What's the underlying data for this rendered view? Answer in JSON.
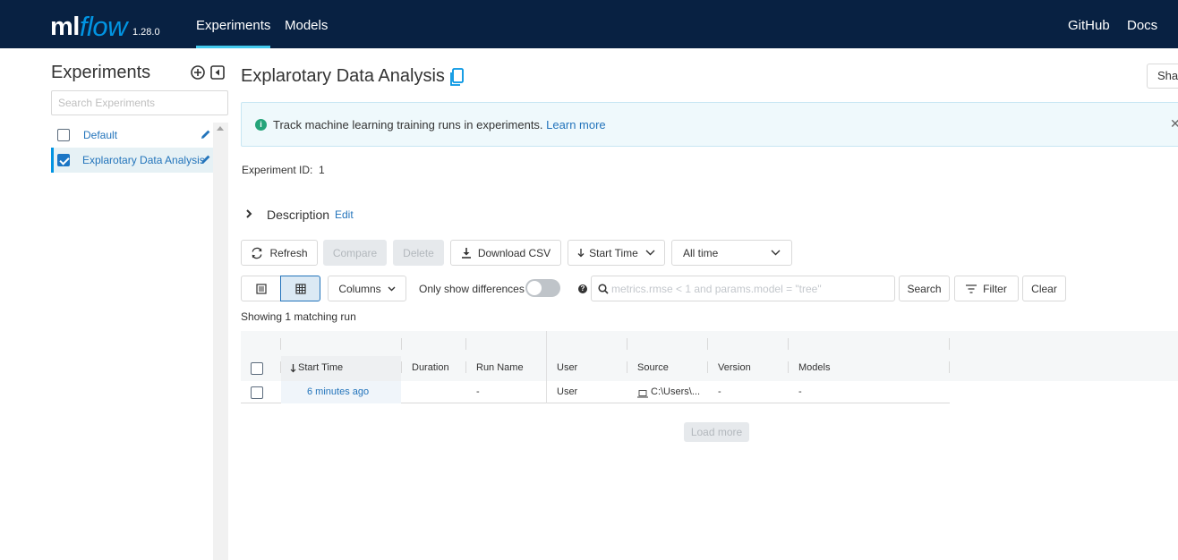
{
  "app": {
    "logo_ml": "ml",
    "logo_flow": "flow",
    "version": "1.28.0"
  },
  "nav": {
    "experiments": "Experiments",
    "models": "Models",
    "github": "GitHub",
    "docs": "Docs"
  },
  "sidebar": {
    "title": "Experiments",
    "search_placeholder": "Search Experiments",
    "items": [
      {
        "label": "Default",
        "checked": false
      },
      {
        "label": "Explarotary Data Analysis",
        "checked": true
      }
    ]
  },
  "experiment": {
    "title": "Explarotary Data Analysis",
    "share_label": "Share",
    "alert_text": "Track machine learning training runs in experiments.",
    "alert_link": "Learn more",
    "id_label": "Experiment ID:",
    "id_value": "1",
    "description_label": "Description",
    "description_edit": "Edit"
  },
  "toolbar": {
    "refresh": "Refresh",
    "compare": "Compare",
    "delete": "Delete",
    "download_csv": "Download CSV",
    "sort": "Start Time",
    "time_range": "All time",
    "columns": "Columns",
    "only_show_differences": "Only show differences",
    "search_placeholder": "metrics.rmse < 1 and params.model = \"tree\"",
    "search": "Search",
    "filter": "Filter",
    "clear": "Clear"
  },
  "runs": {
    "showing": "Showing 1 matching run",
    "columns": [
      "Start Time",
      "Duration",
      "Run Name",
      "User",
      "Source",
      "Version",
      "Models"
    ],
    "rows": [
      {
        "start_time": "6 minutes ago",
        "duration": "",
        "run_name": "-",
        "user": "User",
        "source": "C:\\Users\\...",
        "version": "-",
        "models": "-"
      }
    ],
    "load_more": "Load more"
  },
  "colors": {
    "nav_bg": "#082142",
    "accent": "#0194e2",
    "link": "#2374bb",
    "alert_bg": "#eff9fc"
  }
}
